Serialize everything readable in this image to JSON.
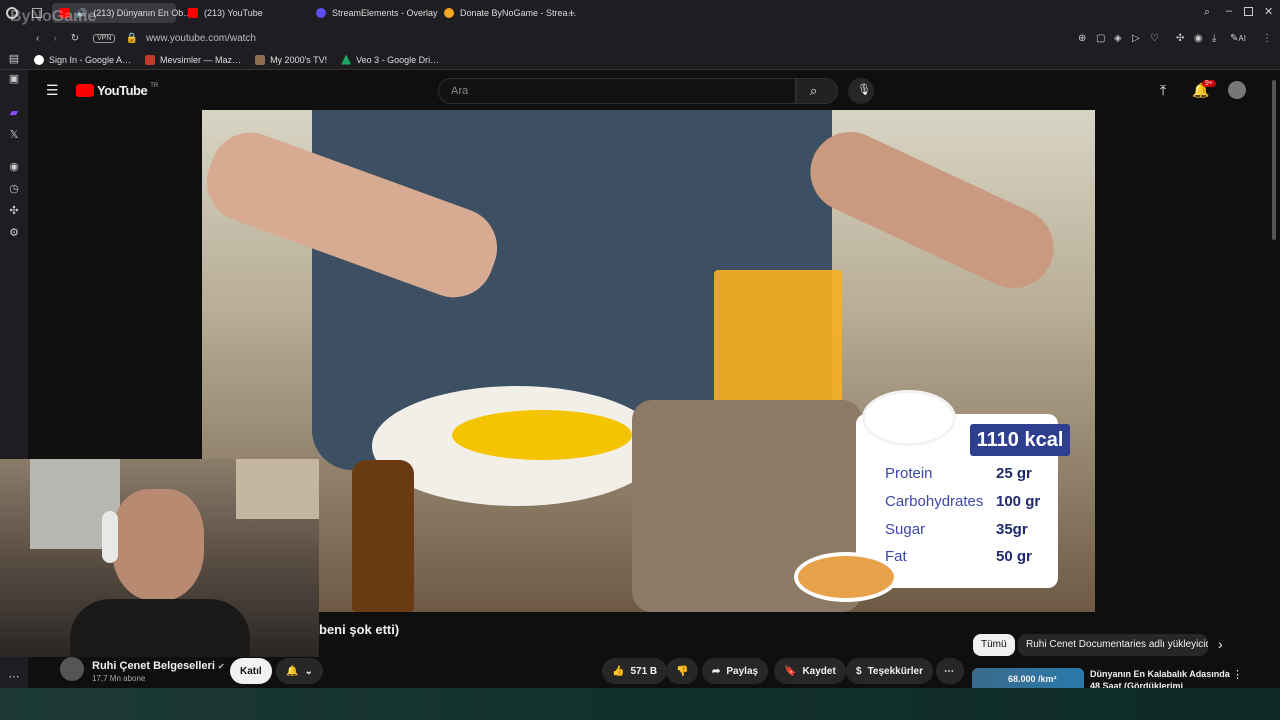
{
  "browser": {
    "tabs": [
      {
        "title": "(213) Dünyanın En Ob…",
        "color": "#ff0000"
      },
      {
        "title": "(213) YouTube",
        "color": "#ff0000"
      },
      {
        "title": "StreamElements - Overlay",
        "color": "#5b4df0"
      },
      {
        "title": "Donate ByNoGame - Strea…",
        "color": "#f5a524"
      }
    ],
    "watermark": "ByNoGame",
    "url": "www.youtube.com/watch",
    "vpn_label": "VPN",
    "ai_label": "AI",
    "bookmarks": [
      {
        "label": "Sign In - Google A…",
        "color": "#ffffff"
      },
      {
        "label": "Mevsimler — Maz…",
        "color": "#c0392b"
      },
      {
        "label": "My 2000's TV!",
        "color": "#8e6e4f"
      },
      {
        "label": "Veo 3 - Google Dri…",
        "color": "#1fa463"
      }
    ]
  },
  "youtube": {
    "logo_text": "YouTube",
    "country": "TR",
    "search_placeholder": "Ara",
    "notif_count": "9+",
    "video_title": "beni şok etti)",
    "nutrition": {
      "kcal": "1110 kcal",
      "rows": [
        {
          "label": "Protein",
          "value": "25 gr"
        },
        {
          "label": "Carbohydrates",
          "value": "100 gr"
        },
        {
          "label": "Sugar",
          "value": "35gr"
        },
        {
          "label": "Fat",
          "value": "50 gr"
        }
      ]
    },
    "channel": {
      "name": "Ruhi Çenet Belgeselleri",
      "subs": "17,7 Mn abone",
      "join_label": "Katıl"
    },
    "actions": {
      "likes": "571 B",
      "share": "Paylaş",
      "save": "Kaydet",
      "thanks": "Teşekkürler"
    },
    "chips": {
      "all": "Tümü",
      "uploader": "Ruhi Cenet Documentaries adlı yükleyicide"
    },
    "recommended": {
      "title": "Dünyanın En Kalabalık Adasında 48 Saat (Gördüklerimi",
      "thumb_text": "68.000 /km²"
    }
  }
}
